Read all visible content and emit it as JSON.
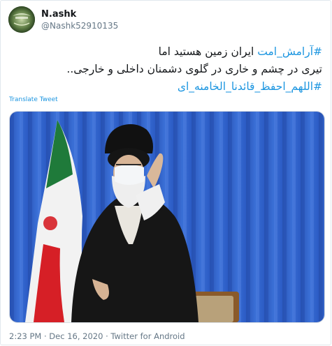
{
  "tweet": {
    "display_name": "N.ashk",
    "handle": "@Nashk52910135",
    "line1_hashtag": "#آرامش_امت",
    "line1_text": " ایران زمین هستید اما",
    "line2_text": "تیری در چشم و خاری در گلوی دشمنان داخلی و خارجی..",
    "line3_hashtag": "#اللهم_احفظ_قائدنا_الخامنه_ای",
    "translate_label": "Translate Tweet",
    "timestamp": "2:23 PM · Dec 16, 2020",
    "separator": " · ",
    "source": "Twitter for Android"
  },
  "colors": {
    "link": "#1b95e0",
    "muted": "#657786",
    "curtain_blue": "#2f62c8"
  },
  "icons": {
    "avatar": "profile-avatar-image",
    "photo": "tweet-photo"
  }
}
